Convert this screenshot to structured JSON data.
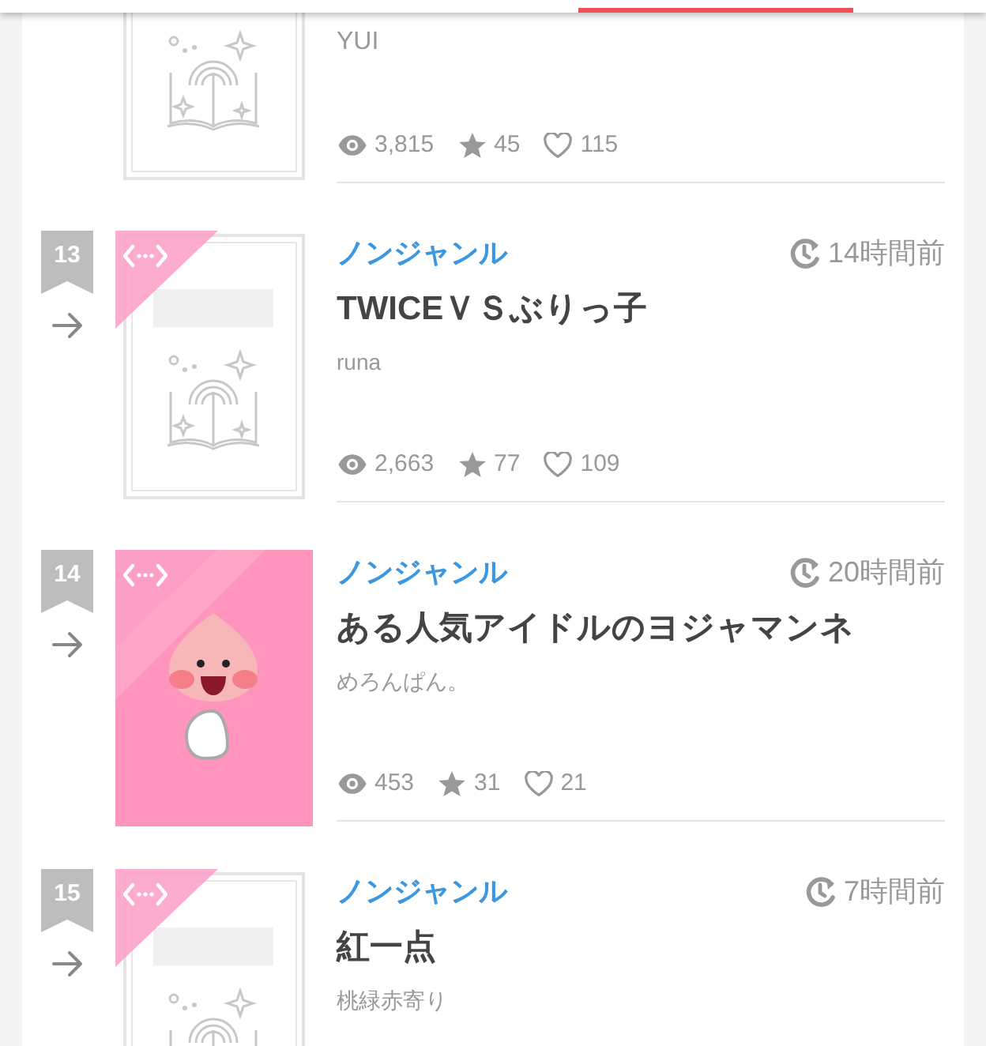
{
  "items": [
    {
      "author": "YUI",
      "views": "3,815",
      "favorites": "45",
      "likes": "115",
      "cover": {
        "kind": "placeholder"
      }
    },
    {
      "rank": "13",
      "genre": "ノンジャンル",
      "time": "14時間前",
      "title": "TWICEＶＳぶりっ子",
      "author": "runa",
      "views": "2,663",
      "favorites": "77",
      "likes": "109",
      "cover": {
        "kind": "placeholder"
      }
    },
    {
      "rank": "14",
      "genre": "ノンジャンル",
      "time": "20時間前",
      "title": "ある人気アイドルのヨジャマンネ",
      "author": "めろんぱん。",
      "views": "453",
      "favorites": "31",
      "likes": "21"
    },
    {
      "rank": "15",
      "genre": "ノンジャンル",
      "time": "7時間前",
      "title": "紅一点",
      "author": "桃緑赤寄り",
      "cover": {
        "kind": "placeholder"
      }
    }
  ]
}
